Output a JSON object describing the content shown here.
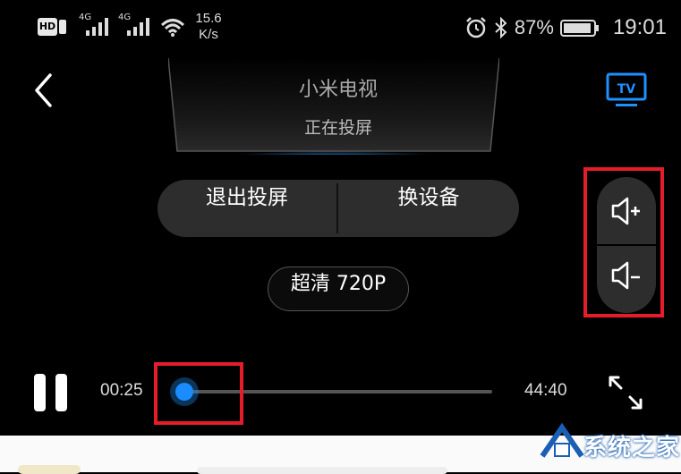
{
  "status_bar": {
    "hd": "HD",
    "net1": "4G",
    "net2": "4G",
    "speed_value": "15.6",
    "speed_unit": "K/s",
    "battery_pct": "87%",
    "time": "19:01"
  },
  "header": {
    "device_name": "小米电视",
    "device_status": "正在投屏",
    "tv_badge": "TV"
  },
  "actions": {
    "exit_cast": "退出投屏",
    "switch_device": "换设备"
  },
  "quality": "超清 720P",
  "player": {
    "current_time": "00:25",
    "total_time": "44:40",
    "progress": 0.009
  },
  "watermark": "系统之家",
  "colors": {
    "accent": "#1a8cff",
    "highlight": "#e51d2a",
    "pill_bg": "#2d2d2d"
  }
}
